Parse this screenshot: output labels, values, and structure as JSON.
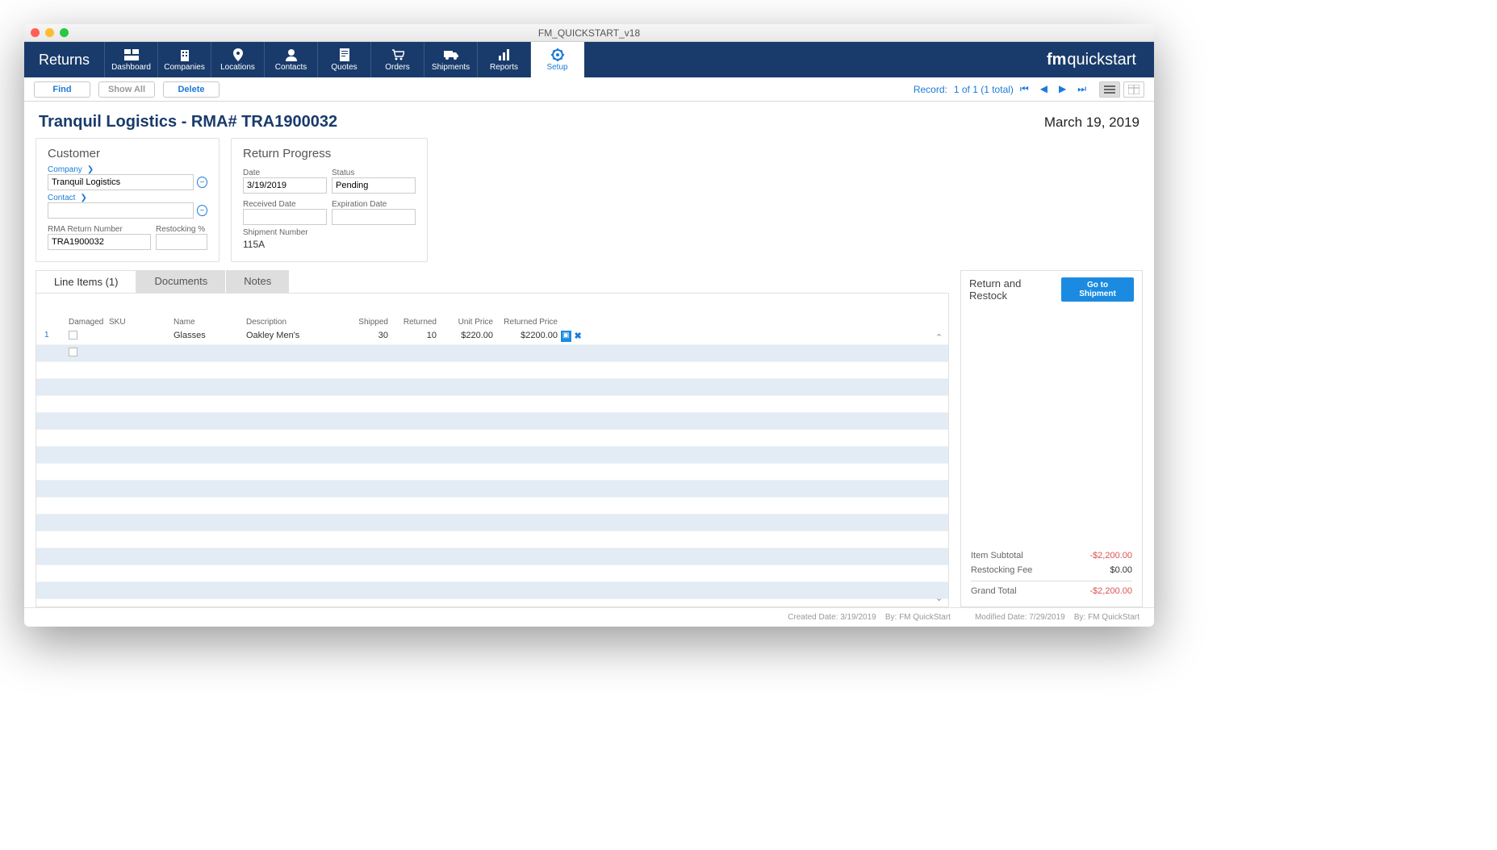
{
  "window": {
    "title": "FM_QUICKSTART_v18"
  },
  "nav": {
    "module": "Returns",
    "brand_prefix": "fm",
    "brand_body": "quickstart",
    "items": [
      {
        "label": "Dashboard"
      },
      {
        "label": "Companies"
      },
      {
        "label": "Locations"
      },
      {
        "label": "Contacts"
      },
      {
        "label": "Quotes"
      },
      {
        "label": "Orders"
      },
      {
        "label": "Shipments"
      },
      {
        "label": "Reports"
      },
      {
        "label": "Setup"
      }
    ],
    "active_index": 8
  },
  "toolbar": {
    "find": "Find",
    "show_all": "Show All",
    "delete": "Delete",
    "record_label": "Record:",
    "record_pos": "1 of 1 (1 total)"
  },
  "header": {
    "title": "Tranquil Logistics - RMA# TRA1900032",
    "date": "March 19, 2019"
  },
  "customer": {
    "panel_title": "Customer",
    "company_label": "Company",
    "company_value": "Tranquil Logistics",
    "contact_label": "Contact",
    "contact_value": "",
    "rma_label": "RMA Return Number",
    "rma_value": "TRA1900032",
    "restocking_label": "Restocking %",
    "restocking_value": ""
  },
  "progress": {
    "panel_title": "Return Progress",
    "date_label": "Date",
    "date_value": "3/19/2019",
    "status_label": "Status",
    "status_value": "Pending",
    "received_label": "Received Date",
    "received_value": "",
    "expiration_label": "Expiration Date",
    "expiration_value": "",
    "shipment_label": "Shipment Number",
    "shipment_value": "115A"
  },
  "tabs": {
    "items": [
      {
        "label": "Line Items (1)"
      },
      {
        "label": "Documents"
      },
      {
        "label": "Notes"
      }
    ],
    "active_index": 0
  },
  "table": {
    "headers": {
      "damaged": "Damaged",
      "sku": "SKU",
      "name": "Name",
      "description": "Description",
      "shipped": "Shipped",
      "returned": "Returned",
      "unit_price": "Unit Price",
      "returned_price": "Returned Price"
    },
    "rows": [
      {
        "idx": "1",
        "damaged": false,
        "sku": "",
        "name": "Glasses",
        "description": "Oakley Men's",
        "shipped": "30",
        "returned": "10",
        "unit_price": "$220.00",
        "returned_price": "$2200.00"
      }
    ]
  },
  "sidebar": {
    "title": "Return and Restock",
    "button": "Go to Shipment",
    "totals": {
      "subtotal_label": "Item Subtotal",
      "subtotal_value": "-$2,200.00",
      "fee_label": "Restocking Fee",
      "fee_value": "$0.00",
      "grand_label": "Grand Total",
      "grand_value": "-$2,200.00"
    }
  },
  "footer": {
    "created_label": "Created Date:",
    "created_date": "3/19/2019",
    "created_by_label": "By:",
    "created_by": "FM QuickStart",
    "modified_label": "Modified Date:",
    "modified_date": "7/29/2019",
    "modified_by_label": "By:",
    "modified_by": "FM QuickStart"
  }
}
